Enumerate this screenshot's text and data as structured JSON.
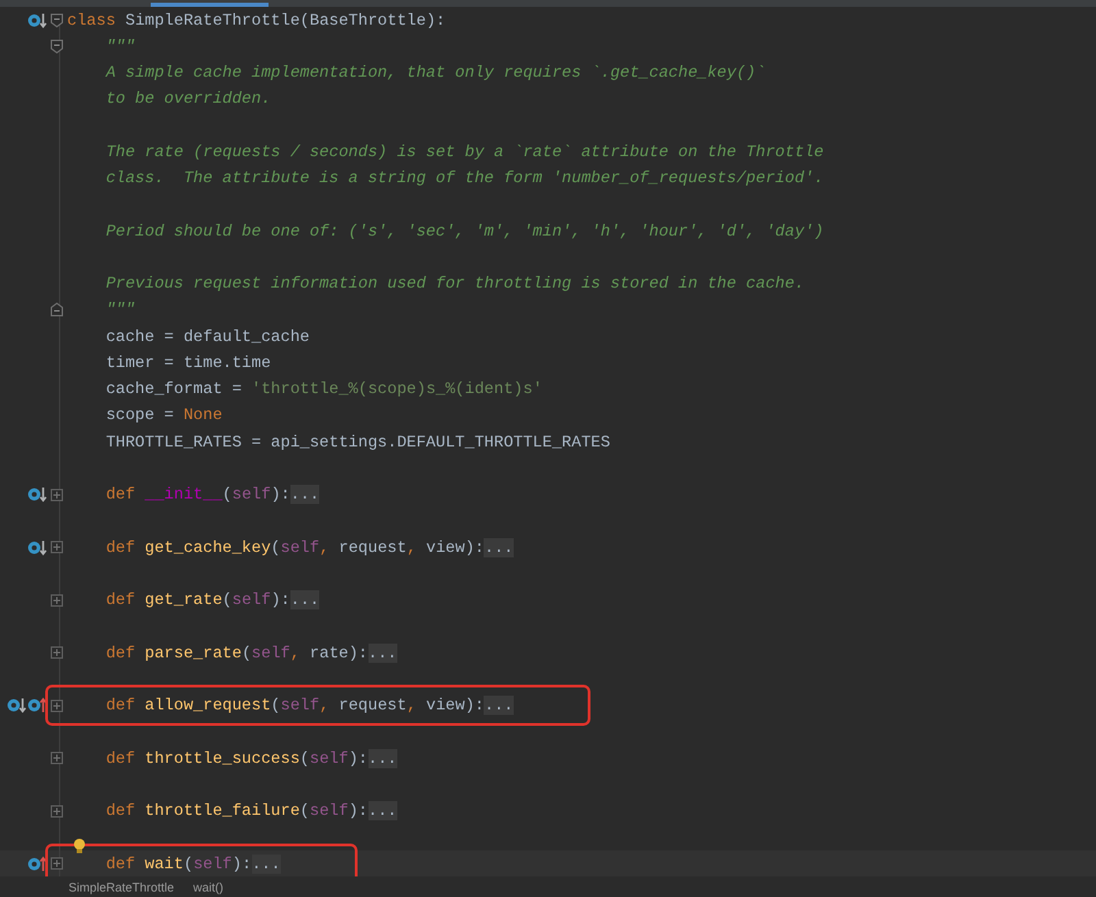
{
  "tab_strip": {
    "active_tab": true
  },
  "lines": [
    {
      "gutter": [
        {
          "kind": "implemented"
        }
      ],
      "fold": {
        "kind": "open"
      },
      "tokens": [
        {
          "kind": "keyword",
          "text": "class "
        },
        {
          "kind": "plain",
          "text": "SimpleRateThrottle(BaseThrottle):"
        }
      ]
    },
    {
      "fold": {
        "kind": "open"
      },
      "tokens": [
        {
          "kind": "docstring",
          "text": "    \"\"\""
        }
      ]
    },
    {
      "tokens": [
        {
          "kind": "docstring",
          "text": "    A simple cache implementation, that only requires `.get_cache_key()`"
        }
      ]
    },
    {
      "blank_line_after": true,
      "tokens": [
        {
          "kind": "docstring",
          "text": "    to be overridden."
        }
      ]
    },
    {
      "tokens": [
        {
          "kind": "docstring",
          "text": "    The rate (requests / seconds) is set by a `rate` attribute on the Throttle"
        }
      ]
    },
    {
      "blank_line_after": true,
      "tokens": [
        {
          "kind": "docstring",
          "text": "    class.  The attribute is a string of the form 'number_of_requests/period'."
        }
      ]
    },
    {
      "blank_line_after": true,
      "tokens": [
        {
          "kind": "docstring",
          "text": "    Period should be one of: ('s', 'sec', 'm', 'min', 'h', 'hour', 'd', 'day')"
        }
      ]
    },
    {
      "tokens": [
        {
          "kind": "docstring",
          "text": "    Previous request information used for throttling is stored in the cache."
        }
      ]
    },
    {
      "fold": {
        "kind": "close"
      },
      "tokens": [
        {
          "kind": "docstring",
          "text": "    \"\"\""
        }
      ]
    },
    {
      "tokens": [
        {
          "kind": "plain",
          "text": "    cache = default_cache"
        }
      ]
    },
    {
      "tokens": [
        {
          "kind": "plain",
          "text": "    timer = time.time"
        }
      ]
    },
    {
      "tokens": [
        {
          "kind": "plain",
          "text": "    cache_format = "
        },
        {
          "kind": "string",
          "text": "'throttle_%(scope)s_%(ident)s'"
        }
      ]
    },
    {
      "tokens": [
        {
          "kind": "plain",
          "text": "    scope = "
        },
        {
          "kind": "keyword",
          "text": "None"
        }
      ]
    },
    {
      "blank_line_after": true,
      "tokens": [
        {
          "kind": "plain",
          "text": "    THROTTLE_RATES = api_settings.DEFAULT_THROTTLE_RATES"
        }
      ]
    },
    {
      "blank_line_after": true,
      "gutter": [
        {
          "kind": "implemented"
        }
      ],
      "fold": {
        "kind": "collapsed"
      },
      "tokens": [
        {
          "kind": "keyword",
          "text": "    def "
        },
        {
          "kind": "magic",
          "text": "__init__"
        },
        {
          "kind": "plain",
          "text": "("
        },
        {
          "kind": "self",
          "text": "self"
        },
        {
          "kind": "plain",
          "text": "):"
        },
        {
          "kind": "folded",
          "text": "..."
        }
      ]
    },
    {
      "blank_line_after": true,
      "gutter": [
        {
          "kind": "implemented"
        }
      ],
      "fold": {
        "kind": "collapsed"
      },
      "tokens": [
        {
          "kind": "keyword",
          "text": "    def "
        },
        {
          "kind": "function",
          "text": "get_cache_key"
        },
        {
          "kind": "plain",
          "text": "("
        },
        {
          "kind": "self",
          "text": "self"
        },
        {
          "kind": "keyword",
          "text": ", "
        },
        {
          "kind": "plain",
          "text": "request"
        },
        {
          "kind": "keyword",
          "text": ", "
        },
        {
          "kind": "plain",
          "text": "view):"
        },
        {
          "kind": "folded",
          "text": "..."
        }
      ]
    },
    {
      "blank_line_after": true,
      "fold": {
        "kind": "collapsed"
      },
      "tokens": [
        {
          "kind": "keyword",
          "text": "    def "
        },
        {
          "kind": "function",
          "text": "get_rate"
        },
        {
          "kind": "plain",
          "text": "("
        },
        {
          "kind": "self",
          "text": "self"
        },
        {
          "kind": "plain",
          "text": "):"
        },
        {
          "kind": "folded",
          "text": "..."
        }
      ]
    },
    {
      "blank_line_after": true,
      "fold": {
        "kind": "collapsed"
      },
      "tokens": [
        {
          "kind": "keyword",
          "text": "    def "
        },
        {
          "kind": "function",
          "text": "parse_rate"
        },
        {
          "kind": "plain",
          "text": "("
        },
        {
          "kind": "self",
          "text": "self"
        },
        {
          "kind": "keyword",
          "text": ", "
        },
        {
          "kind": "plain",
          "text": "rate):"
        },
        {
          "kind": "folded",
          "text": "..."
        }
      ]
    },
    {
      "blank_line_after": true,
      "gutter": [
        {
          "kind": "implemented"
        },
        {
          "kind": "overrides"
        }
      ],
      "fold": {
        "kind": "collapsed"
      },
      "boxed": true,
      "tokens": [
        {
          "kind": "keyword",
          "text": "    def "
        },
        {
          "kind": "function",
          "text": "allow_request"
        },
        {
          "kind": "plain",
          "text": "("
        },
        {
          "kind": "self",
          "text": "self"
        },
        {
          "kind": "keyword",
          "text": ", "
        },
        {
          "kind": "plain",
          "text": "request"
        },
        {
          "kind": "keyword",
          "text": ", "
        },
        {
          "kind": "plain",
          "text": "view):"
        },
        {
          "kind": "folded",
          "text": "..."
        }
      ]
    },
    {
      "blank_line_after": true,
      "fold": {
        "kind": "collapsed"
      },
      "tokens": [
        {
          "kind": "keyword",
          "text": "    def "
        },
        {
          "kind": "function",
          "text": "throttle_success"
        },
        {
          "kind": "plain",
          "text": "("
        },
        {
          "kind": "self",
          "text": "self"
        },
        {
          "kind": "plain",
          "text": "):"
        },
        {
          "kind": "folded",
          "text": "..."
        }
      ]
    },
    {
      "blank_line_after": true,
      "fold": {
        "kind": "collapsed"
      },
      "tokens": [
        {
          "kind": "keyword",
          "text": "    def "
        },
        {
          "kind": "function",
          "text": "throttle_failure"
        },
        {
          "kind": "plain",
          "text": "("
        },
        {
          "kind": "self",
          "text": "self"
        },
        {
          "kind": "plain",
          "text": "):"
        },
        {
          "kind": "folded",
          "text": "..."
        }
      ]
    },
    {
      "gutter": [
        {
          "kind": "overrides"
        }
      ],
      "fold": {
        "kind": "collapsed"
      },
      "current": true,
      "bulb": true,
      "boxed": true,
      "tokens": [
        {
          "kind": "keyword",
          "text": "    def "
        },
        {
          "kind": "function",
          "text": "wait"
        },
        {
          "kind": "plain",
          "text": "("
        },
        {
          "kind": "self",
          "text": "self"
        },
        {
          "kind": "plain",
          "text": "):"
        },
        {
          "kind": "folded",
          "text": "..."
        }
      ]
    }
  ],
  "breadcrumb": [
    "SimpleRateThrottle",
    "wait()"
  ]
}
